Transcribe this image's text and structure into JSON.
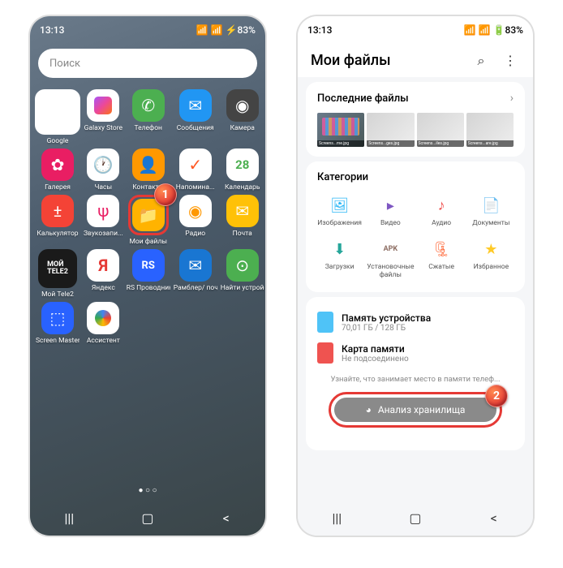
{
  "badges": {
    "one": "1",
    "two": "2"
  },
  "status": {
    "time": "13:13",
    "battery": "83%"
  },
  "phone1": {
    "search_placeholder": "Поиск",
    "apps": [
      {
        "name": "google",
        "label": "Google"
      },
      {
        "name": "galaxy-store",
        "label": "Galaxy Store"
      },
      {
        "name": "telefon",
        "label": "Телефон"
      },
      {
        "name": "messages",
        "label": "Сообщения"
      },
      {
        "name": "camera",
        "label": "Камера"
      },
      {
        "name": "gallery",
        "label": "Галерея"
      },
      {
        "name": "clock",
        "label": "Часы"
      },
      {
        "name": "contacts",
        "label": "Контакты"
      },
      {
        "name": "reminder",
        "label": "Напомина..."
      },
      {
        "name": "calendar",
        "label": "Календарь",
        "date": "28"
      },
      {
        "name": "calculator",
        "label": "Калькулятор"
      },
      {
        "name": "recorder",
        "label": "Звукозапи..."
      },
      {
        "name": "my-files",
        "label": "Мои файлы"
      },
      {
        "name": "radio",
        "label": "Радио"
      },
      {
        "name": "mail",
        "label": "Почта"
      },
      {
        "name": "tele2",
        "label": "Мой Tele2",
        "text": "МОЙ TELE2"
      },
      {
        "name": "yandex",
        "label": "Яндекс",
        "text": "Я"
      },
      {
        "name": "rs",
        "label": "RS Проводник",
        "text": "RS"
      },
      {
        "name": "rambler",
        "label": "Рамблер/ почта"
      },
      {
        "name": "find",
        "label": "Найти устройство"
      },
      {
        "name": "screen-master",
        "label": "Screen Master"
      },
      {
        "name": "assistant",
        "label": "Ассистент"
      }
    ]
  },
  "phone2": {
    "title": "Мои файлы",
    "recent": {
      "title": "Последние файлы"
    },
    "thumbs": [
      "Screens...me.jpg",
      "Screens...ges.jpg",
      "Screens...iles.jpg",
      "Screens...are.jpg"
    ],
    "categories": {
      "title": "Категории",
      "items": [
        {
          "name": "images",
          "label": "Изображения",
          "color": "#29b6f6",
          "glyph": "🖼"
        },
        {
          "name": "video",
          "label": "Видео",
          "color": "#7e57c2",
          "glyph": "▸"
        },
        {
          "name": "audio",
          "label": "Аудио",
          "color": "#ef5350",
          "glyph": "♪"
        },
        {
          "name": "documents",
          "label": "Документы",
          "color": "#ffa726",
          "glyph": "📄"
        },
        {
          "name": "downloads",
          "label": "Загрузки",
          "color": "#26a69a",
          "glyph": "⬇"
        },
        {
          "name": "apk",
          "label": "Установочные файлы",
          "color": "#8d6e63",
          "glyph": "APK"
        },
        {
          "name": "archives",
          "label": "Сжатые",
          "color": "#ff7043",
          "glyph": "🗜"
        },
        {
          "name": "favorites",
          "label": "Избранное",
          "color": "#ffca28",
          "glyph": "★"
        }
      ]
    },
    "storage": {
      "internal": {
        "title": "Память устройства",
        "sub": "70,01 ГБ / 128 ГБ"
      },
      "sd": {
        "title": "Карта памяти",
        "sub": "Не подсоединено"
      }
    },
    "hint": "Узнайте, что занимает место в памяти телеф...",
    "analyze": "Анализ хранилища"
  }
}
